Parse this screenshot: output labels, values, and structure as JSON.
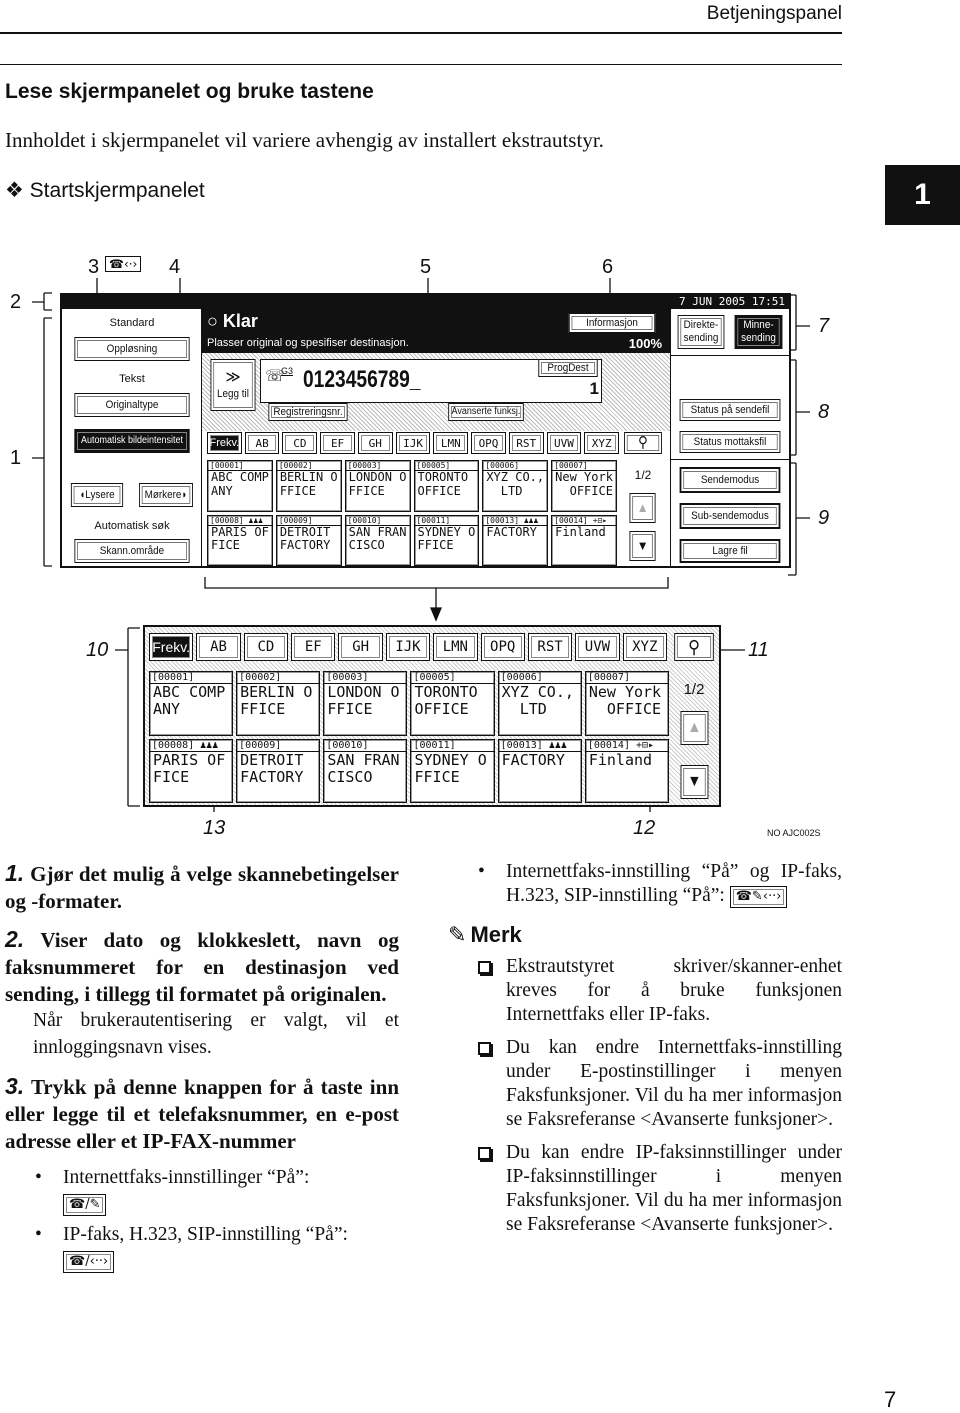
{
  "header": {
    "running_title": "Betjeningspanel",
    "chapter_tab": "1",
    "page_number": "7"
  },
  "section": {
    "title": "Lese skjermpanelet og bruke tastene",
    "intro": "Innholdet i skjermpanelet vil variere avhengig av installert ekstrautstyr.",
    "subsection_marker": "❖",
    "subsection": "Startskjermpanelet"
  },
  "callouts": {
    "c1": "1",
    "c2": "2",
    "c3": "3",
    "c4": "4",
    "c5": "5",
    "c6": "6",
    "c7": "7",
    "c8": "8",
    "c9": "9",
    "c10": "10",
    "c11": "11",
    "c12": "12",
    "c13": "13",
    "figure_code": "NO AJC002S"
  },
  "screen": {
    "datetime": "7 JUN  2005 17:51",
    "left": {
      "standard": "Standard",
      "resolution": "Oppløsning",
      "text": "Tekst",
      "original_type": "Originaltype",
      "auto_density": "Automatisk bildeintensitet",
      "lighter": "◖Lysere",
      "darker": "Mørkere◗",
      "auto_search": "Automatisk søk",
      "scan_area": "Skann.område"
    },
    "status": {
      "title": "Klar",
      "message": "Plasser original og spesifiser destinasjon.",
      "info_button": "Informasjon",
      "percent": "100%"
    },
    "entry": {
      "add_arrows": "≫",
      "add_label": "Legg til",
      "line_mode": "G3",
      "number": "0123456789_",
      "progdest": "ProgDest",
      "progdest_value": "1",
      "reg_no": "Registreringsnr.",
      "advanced": "Avanserte funksj."
    },
    "tabs": [
      "Frekv.",
      "AB",
      "CD",
      "EF",
      "GH",
      "IJK",
      "LMN",
      "OPQ",
      "RST",
      "UVW",
      "XYZ"
    ],
    "search_icon": "magnifier-icon",
    "destinations": [
      {
        "id": "[00001]",
        "name": "ABC COMP\nANY"
      },
      {
        "id": "[00002]",
        "name": "BERLIN O\nFFICE"
      },
      {
        "id": "[00003]",
        "name": "LONDON O\nFFICE"
      },
      {
        "id": "[00005]",
        "name": "TORONTO\nOFFICE"
      },
      {
        "id": "[00006]",
        "name": "XYZ CO.,\n  LTD"
      },
      {
        "id": "[00007]",
        "name": "New York\n  OFFICE"
      },
      {
        "id": "[00008] ♟♟♟",
        "name": "PARIS OF\nFICE"
      },
      {
        "id": "[00009]",
        "name": "DETROIT\nFACTORY"
      },
      {
        "id": "[00010]",
        "name": "SAN FRAN\nCISCO"
      },
      {
        "id": "[00011]",
        "name": "SYDNEY O\nFFICE"
      },
      {
        "id": "[00013] ♟♟♟",
        "name": "FACTORY"
      },
      {
        "id": "[00014] +⊟▸",
        "name": "Finland"
      }
    ],
    "page_indicator": "1/2",
    "page_up": "▲",
    "page_down": "▼",
    "right": {
      "direct_send": "Direkte-\nsending",
      "memory_send": "Minne-\nsending",
      "send_file_status": "Status på sendefil",
      "receive_file_status": "Status mottaksfil",
      "send_mode": "Sendemodus",
      "sub_send_mode": "Sub-sendemodus",
      "store_file": "Lagre fil"
    }
  },
  "legend": {
    "item1": {
      "num": "1.",
      "text": "Gjør det mulig å velge skannebetingelser og -formater."
    },
    "item2": {
      "num": "2.",
      "text": "Viser dato og klokkeslett, navn og faksnummeret for en destinasjon ved sending, i tillegg til formatet på originalen.",
      "note": "Når brukerautentisering er valgt, vil et innloggingsnavn vises."
    },
    "item3": {
      "num": "3.",
      "text": "Trykk på denne knappen for å taste inn eller legge til et telefaksnummer, en e-post adresse eller et IP-FAX-nummer",
      "bullets": [
        {
          "text": "Internettfaks-innstillinger “På”:",
          "icon": "☎/✎"
        },
        {
          "text": "IP-faks, H.323, SIP-innstilling “På”:",
          "icon": "☎/‹··›"
        },
        {
          "text": "Internettfaks-innstilling “På” og IP-faks, H.323, SIP-innstilling “På”:",
          "icon": "☎✎‹··›"
        }
      ]
    },
    "note_title": "Merk",
    "notes": [
      "Ekstrautstyret skriver/skanner-enhet kreves for å bruke funksjonen Internettfaks eller IP-faks.",
      "Du kan endre Internettfaks-innstilling under E-postinstillinger i menyen Faksfunksjoner. Vil du ha mer informasjon se Faksreferanse <Avanserte funksjoner>.",
      "Du kan endre IP-faksinnstillinger under IP-faksinnstillinger i menyen Faksfunksjoner. Vil du ha mer informasjon se Faksreferanse <Avanserte funksjoner>."
    ]
  }
}
